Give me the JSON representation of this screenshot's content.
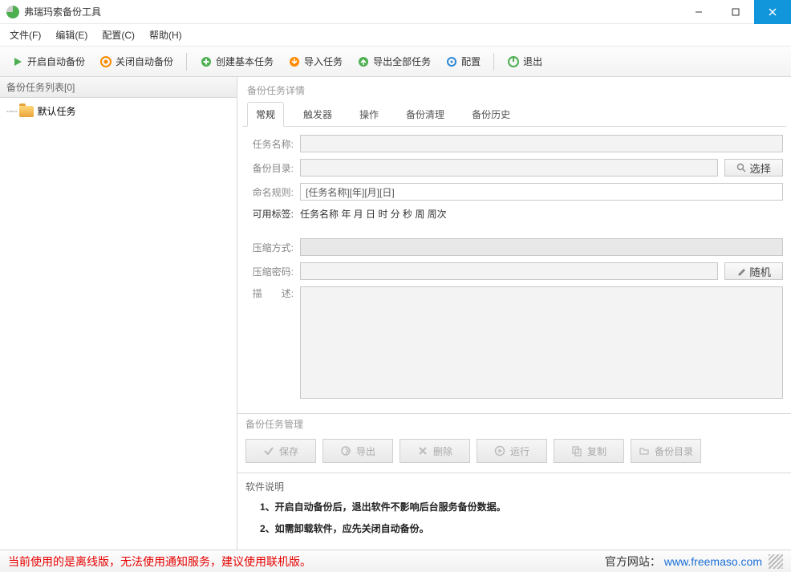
{
  "window": {
    "title": "弗瑞玛索备份工具"
  },
  "menu": {
    "file": "文件(F)",
    "edit": "编辑(E)",
    "config": "配置(C)",
    "help": "帮助(H)"
  },
  "toolbar": {
    "start": "开启自动备份",
    "stop": "关闭自动备份",
    "createTask": "创建基本任务",
    "import": "导入任务",
    "exportAll": "导出全部任务",
    "settings": "配置",
    "exit": "退出"
  },
  "sidebar": {
    "title": "备份任务列表[0]",
    "defaultTask": "默认任务"
  },
  "detail": {
    "groupTitle": "备份任务详情",
    "tabs": [
      "常规",
      "触发器",
      "操作",
      "备份清理",
      "备份历史"
    ],
    "labels": {
      "taskName": "任务名称:",
      "backupDir": "备份目录:",
      "nameRule": "命名规则:",
      "availTags": "可用标签:",
      "compressMode": "压缩方式:",
      "compressPwd": "压缩密码:",
      "desc": "描　　述:"
    },
    "nameRuleValue": "[任务名称][年][月][日]",
    "availTagsText": "任务名称  年  月  日  时  分  秒  周  周次",
    "selectBtn": "选择",
    "randomBtn": "随机"
  },
  "mgmt": {
    "title": "备份任务管理",
    "save": "保存",
    "export": "导出",
    "delete": "删除",
    "run": "运行",
    "copy": "复制",
    "backupDir": "备份目录"
  },
  "instr": {
    "title": "软件说明",
    "line1": "1、开启自动备份后，退出软件不影响后台服务备份数据。",
    "line2": "2、如需卸载软件，应先关闭自动备份。"
  },
  "status": {
    "offline": "当前使用的是离线版，无法使用通知服务，建议使用联机版。",
    "siteLabel": "官方网站：",
    "siteUrl": "www.freemaso.com"
  }
}
